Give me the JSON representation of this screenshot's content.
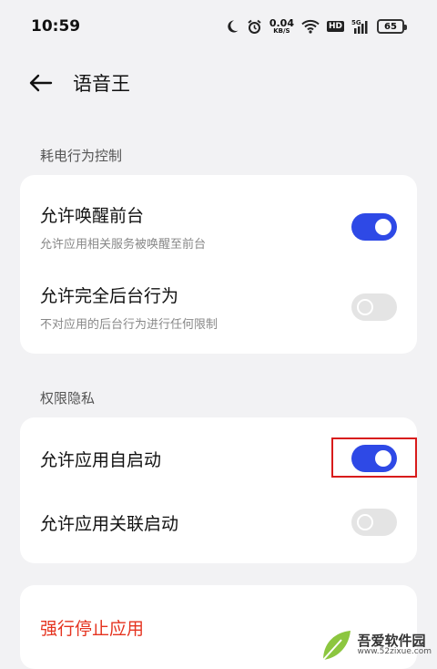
{
  "status_bar": {
    "time": "10:59",
    "net_speed_value": "0.04",
    "net_speed_unit": "KB/S",
    "hd": "HD",
    "signal_label": "5G",
    "battery": "65",
    "icons": [
      "moon-icon",
      "alarm-icon",
      "wifi-icon",
      "signal-icon",
      "battery-icon"
    ]
  },
  "header": {
    "title": "语音王"
  },
  "sections": [
    {
      "label": "耗电行为控制",
      "items": [
        {
          "title": "允许唤醒前台",
          "subtitle": "允许应用相关服务被唤醒至前台",
          "enabled": true
        },
        {
          "title": "允许完全后台行为",
          "subtitle": "不对应用的后台行为进行任何限制",
          "enabled": false
        }
      ]
    },
    {
      "label": "权限隐私",
      "items": [
        {
          "title": "允许应用自启动",
          "enabled": true
        },
        {
          "title": "允许应用关联启动",
          "enabled": false
        }
      ]
    }
  ],
  "action": {
    "force_stop": "强行停止应用"
  },
  "watermark": {
    "name": "吾爱软件园",
    "url": "www.52zixue.com"
  },
  "colors": {
    "accent": "#2e49e6",
    "danger": "#e5331f",
    "highlight": "#d81b1b",
    "background": "#f2f2f4"
  }
}
